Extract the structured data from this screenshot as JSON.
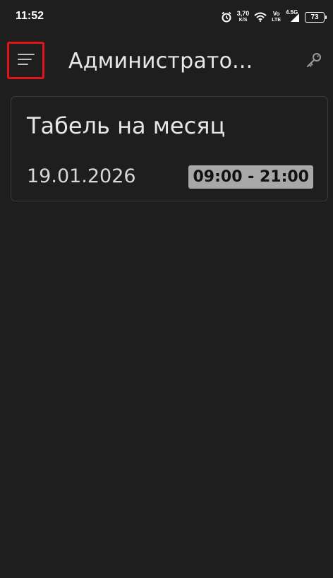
{
  "status_bar": {
    "time": "11:52",
    "net_speed_value": "3,70",
    "net_speed_unit": "K/S",
    "volte_top": "Vo",
    "volte_bottom": "LTE",
    "network_type": "4.5G",
    "battery_level": "73",
    "icons": [
      "alarm-icon",
      "wifi-icon",
      "signal-icon",
      "battery-icon"
    ]
  },
  "app_bar": {
    "title": "Администрато...",
    "menu_icon": "menu-icon",
    "key_icon": "key-icon",
    "menu_highlight_color": "#e0141b"
  },
  "cards": [
    {
      "title": "Табель на месяц",
      "date": "19.01.2026",
      "time_range": "09:00 - 21:00"
    }
  ],
  "colors": {
    "background": "#1e1e1e",
    "card_border": "#3a3a3a",
    "badge_background": "#a8a8a8",
    "text": "#e6e6e6"
  }
}
